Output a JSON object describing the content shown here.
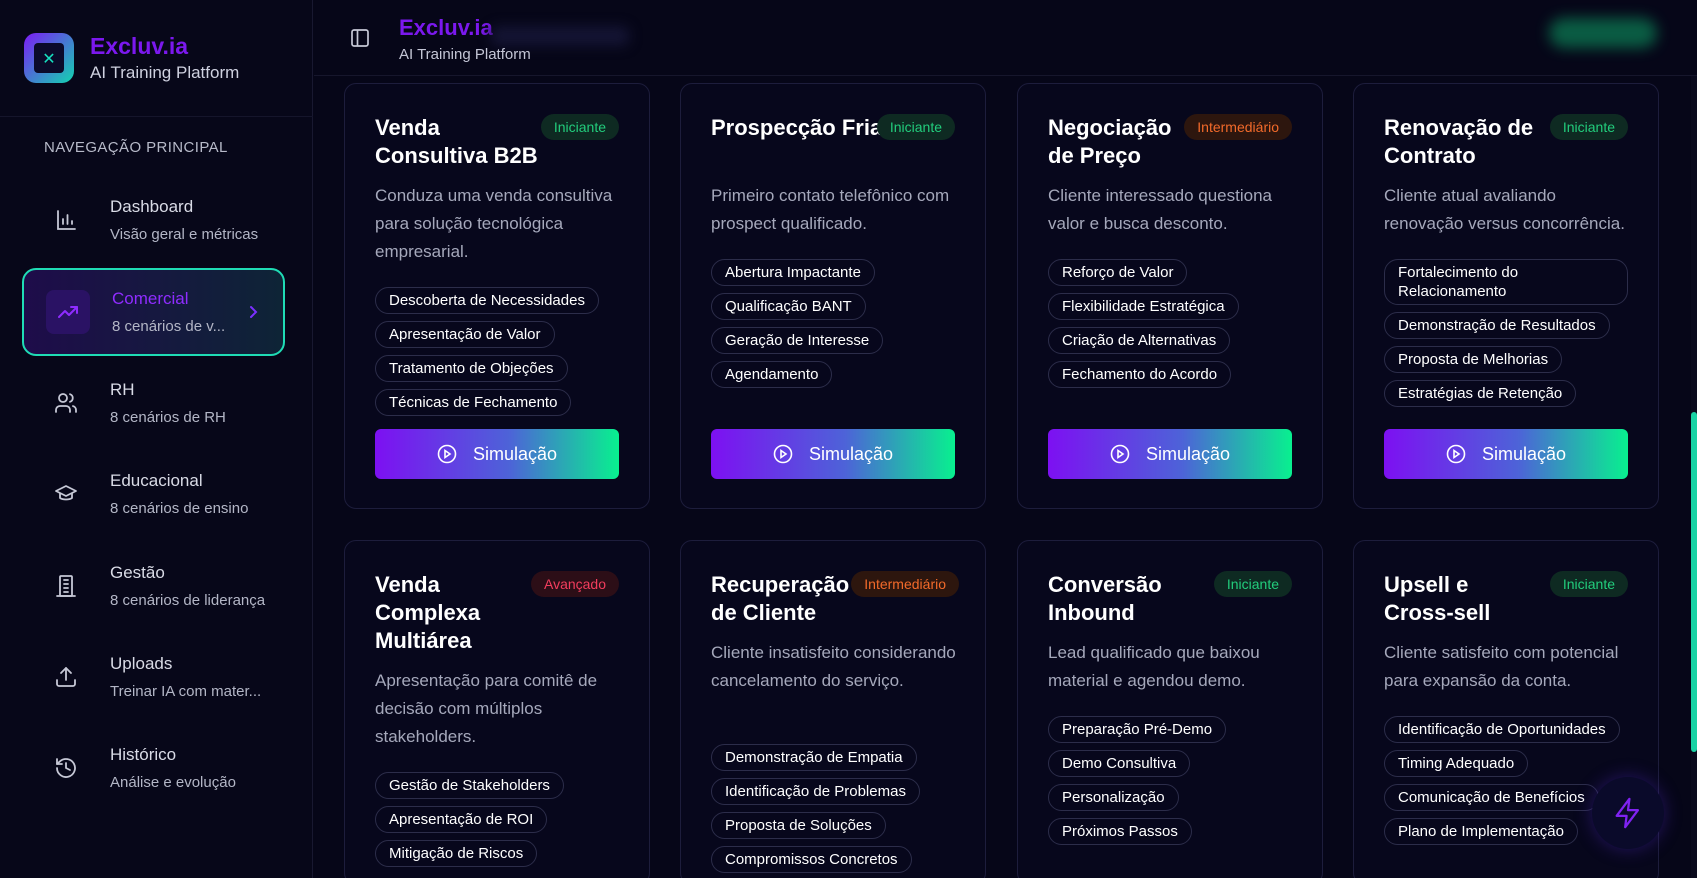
{
  "brand": {
    "name": "Excluv.ia",
    "subtitle": "AI Training Platform"
  },
  "header": {
    "title": "Excluv.ia",
    "subtitle": "AI Training Platform"
  },
  "sidebar": {
    "heading": "NAVEGAÇÃO PRINCIPAL",
    "items": [
      {
        "title": "Dashboard",
        "desc": "Visão geral e métricas",
        "icon": "bar-chart-icon",
        "active": false
      },
      {
        "title": "Comercial",
        "desc": "8 cenários de v...",
        "icon": "trending-up-icon",
        "active": true
      },
      {
        "title": "RH",
        "desc": "8 cenários de RH",
        "icon": "users-icon",
        "active": false
      },
      {
        "title": "Educacional",
        "desc": "8 cenários de ensino",
        "icon": "graduation-cap-icon",
        "active": false
      },
      {
        "title": "Gestão",
        "desc": "8 cenários de liderança",
        "icon": "building-icon",
        "active": false
      },
      {
        "title": "Uploads",
        "desc": "Treinar IA com mater...",
        "icon": "upload-icon",
        "active": false
      },
      {
        "title": "Histórico",
        "desc": "Análise e evolução",
        "icon": "history-icon",
        "active": false
      }
    ]
  },
  "colors": {
    "accent_purple": "#7b18ee",
    "accent_teal": "#1fdcb5",
    "badge_green": "#22cc7c",
    "badge_orange": "#f26a2a",
    "badge_red": "#f33d5d"
  },
  "button_label": "Simulação",
  "cards": [
    {
      "title": "Venda Consultiva B2B",
      "badge": "Iniciante",
      "level": "green",
      "desc": "Conduza uma venda consultiva para solução tecnológica empresarial.",
      "tags": [
        "Descoberta de Necessidades",
        "Apresentação de Valor",
        "Tratamento de Objeções",
        "Técnicas de Fechamento"
      ]
    },
    {
      "title": "Prospecção Fria",
      "badge": "Iniciante",
      "level": "green",
      "desc": "Primeiro contato telefônico com prospect qualificado.",
      "tags": [
        "Abertura Impactante",
        "Qualificação BANT",
        "Geração de Interesse",
        "Agendamento"
      ]
    },
    {
      "title": "Negociação de Preço",
      "badge": "Intermediário",
      "level": "orange",
      "desc": "Cliente interessado questiona valor e busca desconto.",
      "tags": [
        "Reforço de Valor",
        "Flexibilidade Estratégica",
        "Criação de Alternativas",
        "Fechamento do Acordo"
      ]
    },
    {
      "title": "Renovação de Contrato",
      "badge": "Iniciante",
      "level": "green",
      "desc": "Cliente atual avaliando renovação versus concorrência.",
      "tags": [
        "Fortalecimento do Relacionamento",
        "Demonstração de Resultados",
        "Proposta de Melhorias",
        "Estratégias de Retenção"
      ]
    },
    {
      "title": "Venda Complexa Multiárea",
      "badge": "Avançado",
      "level": "red",
      "desc": "Apresentação para comitê de decisão com múltiplos stakeholders.",
      "tags": [
        "Gestão de Stakeholders",
        "Apresentação de ROI",
        "Mitigação de Riscos"
      ]
    },
    {
      "title": "Recuperação de Cliente",
      "badge": "Intermediário",
      "level": "orange",
      "desc": "Cliente insatisfeito considerando cancelamento do serviço.",
      "tags": [
        "Demonstração de Empatia",
        "Identificação de Problemas",
        "Proposta de Soluções",
        "Compromissos Concretos"
      ]
    },
    {
      "title": "Conversão Inbound",
      "badge": "Iniciante",
      "level": "green",
      "desc": "Lead qualificado que baixou material e agendou demo.",
      "tags": [
        "Preparação Pré-Demo",
        "Demo Consultiva",
        "Personalização",
        "Próximos Passos"
      ]
    },
    {
      "title": "Upsell e Cross-sell",
      "badge": "Iniciante",
      "level": "green",
      "desc": "Cliente satisfeito com potencial para expansão da conta.",
      "tags": [
        "Identificação de Oportunidades",
        "Timing Adequado",
        "Comunicação de Benefícios",
        "Plano de Implementação"
      ]
    }
  ]
}
